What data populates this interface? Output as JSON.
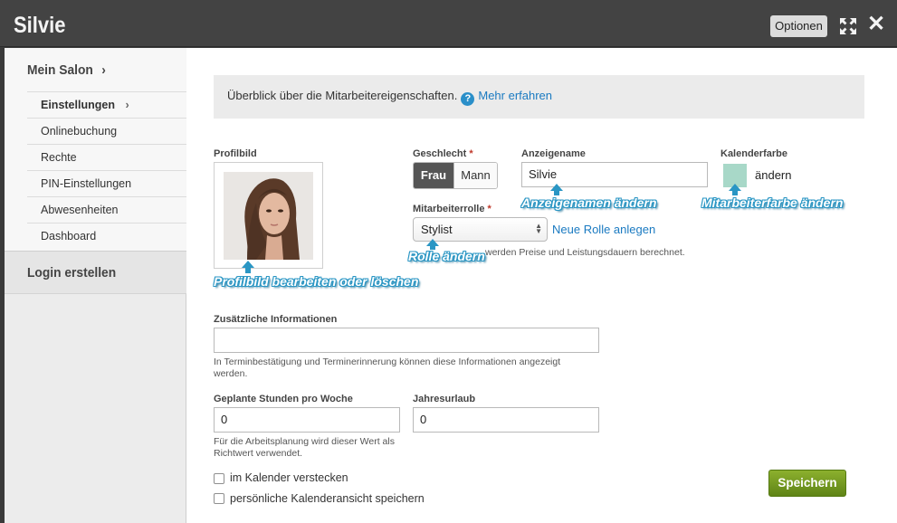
{
  "window": {
    "title": "Silvie",
    "options_label": "Optionen"
  },
  "sidebar": {
    "section1": "Mein Salon",
    "items": [
      {
        "label": "Einstellungen"
      },
      {
        "label": "Onlinebuchung"
      },
      {
        "label": "Rechte"
      },
      {
        "label": "PIN-Einstellungen"
      },
      {
        "label": "Abwesenheiten"
      },
      {
        "label": "Dashboard"
      }
    ],
    "section2": "Login erstellen"
  },
  "info": {
    "text": "Überblick über die Mitarbeitereigenschaften.",
    "link": "Mehr erfahren"
  },
  "form": {
    "profilbild_label": "Profilbild",
    "geschlecht_label": "Geschlecht",
    "gender_options": [
      "Frau",
      "Mann"
    ],
    "gender_selected": "Frau",
    "anzeigename_label": "Anzeigename",
    "anzeigename_value": "Silvie",
    "kalenderfarbe_label": "Kalenderfarbe",
    "kalenderfarbe_color": "#a8d8c8",
    "kalenderfarbe_link": "ändern",
    "rolle_label": "Mitarbeiterrolle",
    "rolle_value": "Stylist",
    "rolle_link": "Neue Rolle anlegen",
    "rolle_hint": "werden Preise und Leistungsdauern berechnet.",
    "zusatz_label": "Zusätzliche Informationen",
    "zusatz_value": "",
    "zusatz_hint": "In Terminbestätigung und Terminerinnerung können diese Informationen angezeigt werden.",
    "stunden_label": "Geplante Stunden pro Woche",
    "stunden_value": "0",
    "stunden_hint": "Für die Arbeitsplanung wird dieser Wert als Richtwert verwendet.",
    "urlaub_label": "Jahresurlaub",
    "urlaub_value": "0",
    "check1": "im Kalender verstecken",
    "check2": "persönliche Kalenderansicht speichern",
    "save_label": "Speichern"
  },
  "callouts": {
    "profil": "Profilbild bearbeiten oder löschen",
    "rolle": "Rolle ändern",
    "name": "Anzeigenamen ändern",
    "farbe": "Mitarbeiterfarbe ändern"
  },
  "colors": {
    "accent": "#2a96c4",
    "save": "#6f951e",
    "titlebar": "#434343"
  }
}
